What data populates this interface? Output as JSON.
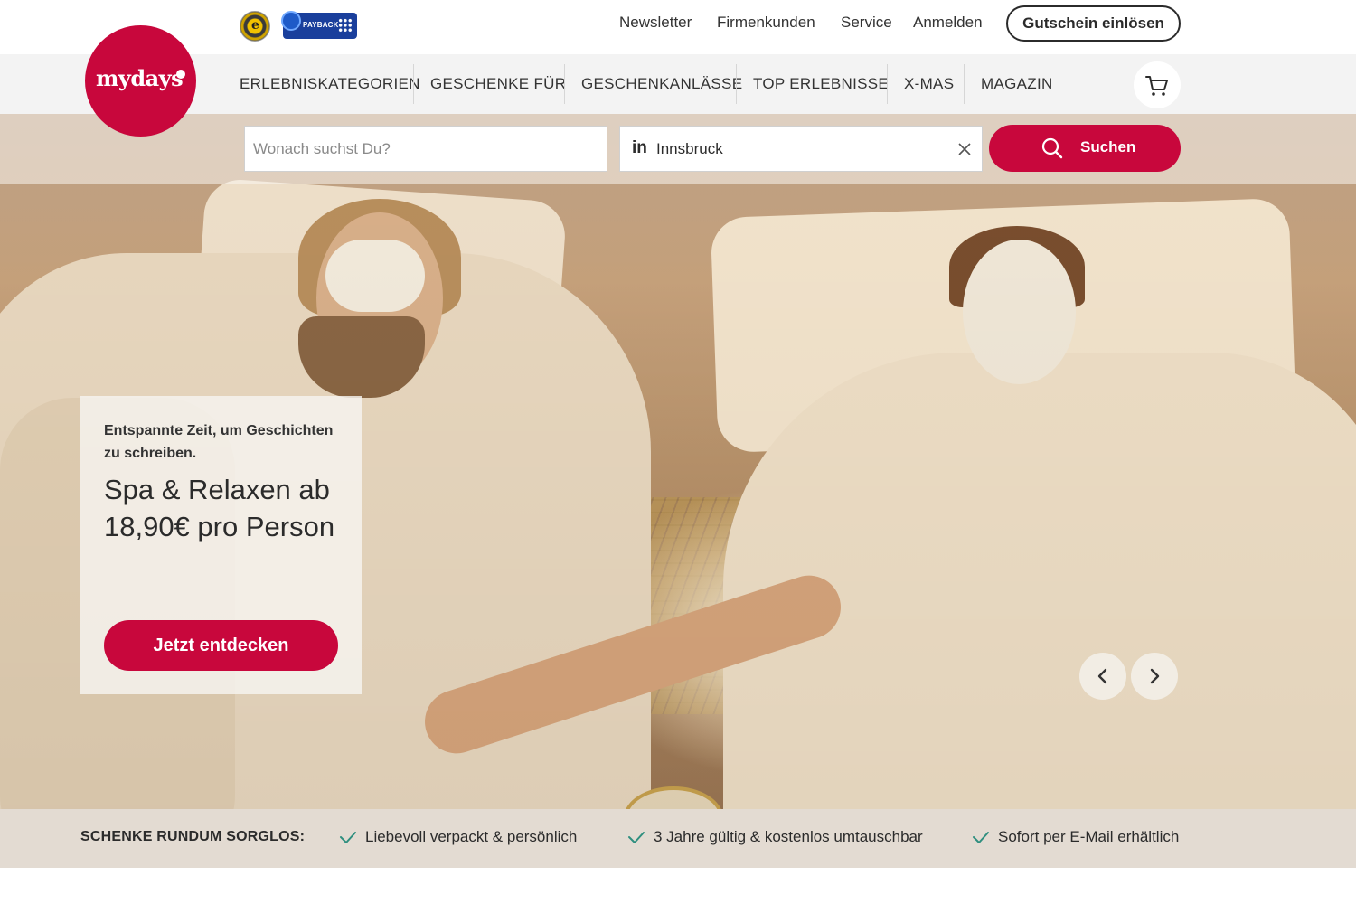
{
  "utility_nav": {
    "links": [
      "Newsletter",
      "Firmenkunden",
      "Service",
      "Anmelden"
    ],
    "voucher_button": "Gutschein einlösen"
  },
  "badges": {
    "trusted_shops_mark": "e",
    "payback": "PAYBACK"
  },
  "logo": {
    "text": "mydays"
  },
  "main_nav": {
    "items": [
      "ERLEBNISKATEGORIEN",
      "GESCHENKE FÜR",
      "GESCHENKANLÄSSE",
      "TOP ERLEBNISSE",
      "X-MAS",
      "MAGAZIN"
    ]
  },
  "search": {
    "query_placeholder": "Wonach suchst Du?",
    "location_prefix": "in",
    "location_value": "Innsbruck",
    "button_label": "Suchen"
  },
  "promo": {
    "eyebrow": "Entspannte Zeit, um Geschichten zu schreiben.",
    "headline": "Spa & Relaxen ab 18,90€ pro Person",
    "cta": "Jetzt entdecken"
  },
  "usp_bar": {
    "title": "SCHENKE RUNDUM SORGLOS:",
    "items": [
      "Liebevoll verpackt & persönlich",
      "3 Jahre gültig & kostenlos umtauschbar",
      "Sofort per E-Mail erhältlich"
    ]
  },
  "colors": {
    "brand": "#c8073c",
    "usp_background": "#e3dbd2",
    "nav_background": "#f3f3f3",
    "check": "#2f8f7f"
  }
}
